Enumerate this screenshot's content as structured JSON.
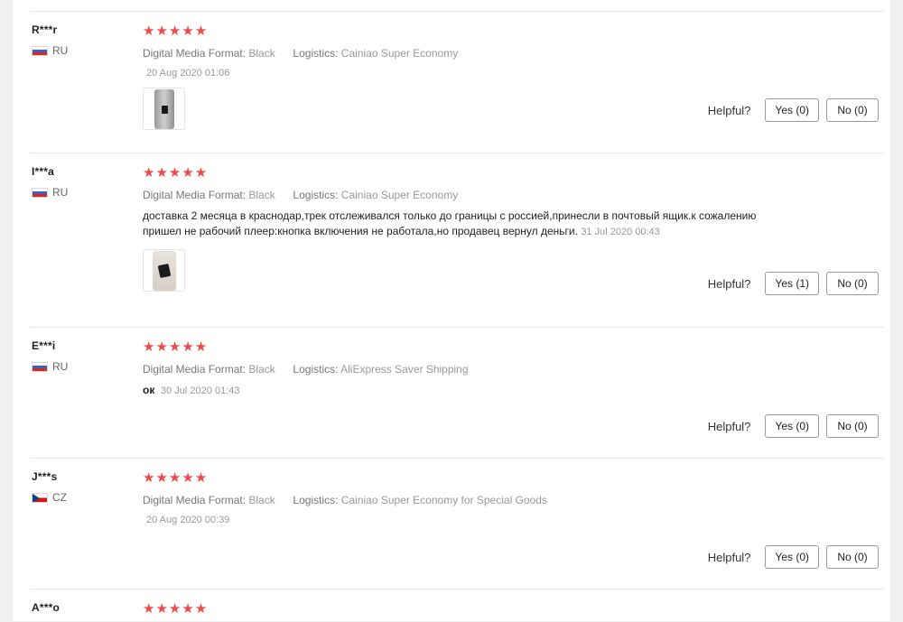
{
  "helpful_label": "Helpful?",
  "attr_labels": {
    "format": "Digital Media Format:",
    "logistics": "Logistics:"
  },
  "colors": {
    "star": "#ee4a4a",
    "panel_bg": "#ffffff",
    "page_bg": "#f0f0f0"
  },
  "reviews": [
    {
      "user": "R***r",
      "country": "RU",
      "rating": 5,
      "stars": "★★★★★",
      "format": "Black",
      "logistics": "Cainiao Super Economy",
      "text": "",
      "date": "20 Aug 2020 01:06",
      "photo": "player-photo",
      "yes": "Yes (0)",
      "no": "No (0)"
    },
    {
      "user": "I***a",
      "country": "RU",
      "rating": 5,
      "stars": "★★★★★",
      "format": "Black",
      "logistics": "Cainiao Super Economy",
      "text": "доставка 2 месяца в краснодар,трек отслеживался только до границы с россией,принесли в почтовый ящик.к сожалению пришел не рабочий плеер:кнопка включения не работала,но продавец вернул деньги.",
      "date": "31 Jul 2020 00:43",
      "photo": "player-photo",
      "yes": "Yes (1)",
      "no": "No (0)"
    },
    {
      "user": "E***i",
      "country": "RU",
      "rating": 5,
      "stars": "★★★★★",
      "format": "Black",
      "logistics": "AliExpress Saver Shipping",
      "text": "ок",
      "date": "30 Jul 2020 01:43",
      "yes": "Yes (0)",
      "no": "No (0)"
    },
    {
      "user": "J***s",
      "country": "CZ",
      "rating": 5,
      "stars": "★★★★★",
      "format": "Black",
      "logistics": "Cainiao Super Economy for Special Goods",
      "text": "",
      "date": "20 Aug 2020 00:39",
      "yes": "Yes (0)",
      "no": "No (0)"
    },
    {
      "user": "A***o",
      "rating": 5,
      "stars": "★★★★★"
    }
  ]
}
